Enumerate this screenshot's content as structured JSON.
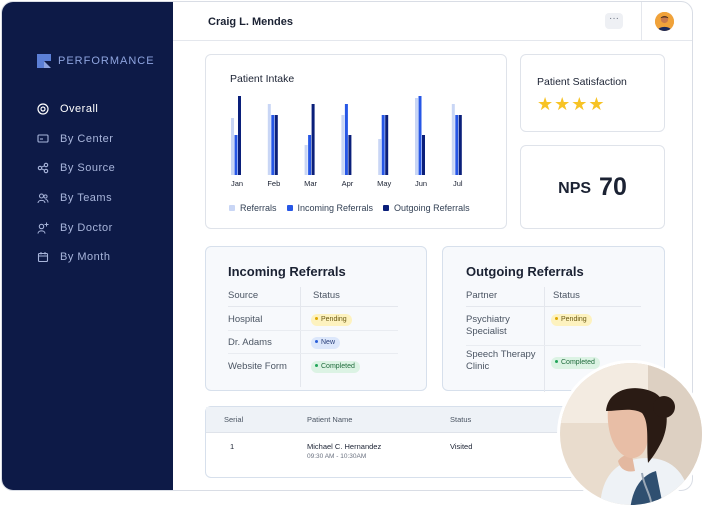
{
  "sidebar": {
    "brand": "PERFORMANCE",
    "items": [
      {
        "label": "Overall",
        "icon": "dashboard-icon",
        "active": true
      },
      {
        "label": "By Center",
        "icon": "monitor-icon",
        "active": false
      },
      {
        "label": "By Source",
        "icon": "share-icon",
        "active": false
      },
      {
        "label": "By Teams",
        "icon": "team-icon",
        "active": false
      },
      {
        "label": "By Doctor",
        "icon": "doctor-add-icon",
        "active": false
      },
      {
        "label": "By Month",
        "icon": "calendar-icon",
        "active": false
      }
    ]
  },
  "header": {
    "user_name": "Craig L. Mendes",
    "more_label": "···"
  },
  "patient_intake": {
    "title": "Patient Intake",
    "chart_data": {
      "type": "bar",
      "categories": [
        "Jan",
        "Feb",
        "Mar",
        "Apr",
        "May",
        "Jun",
        "Jul"
      ],
      "series": [
        {
          "name": "Referrals",
          "color": "#c9d6f5",
          "values": [
            57,
            71,
            30,
            60,
            36,
            77,
            71
          ]
        },
        {
          "name": "Incoming Referrals",
          "color": "#2757e6",
          "values": [
            40,
            60,
            40,
            71,
            60,
            79,
            60
          ]
        },
        {
          "name": "Outgoing Referrals",
          "color": "#0a1f7a",
          "values": [
            79,
            60,
            71,
            40,
            60,
            40,
            60
          ]
        }
      ],
      "ylim": [
        0,
        80
      ],
      "legend": "bottom"
    }
  },
  "satisfaction": {
    "title": "Patient Satisfaction",
    "rating": 4,
    "star_glyph": "★"
  },
  "nps": {
    "label": "NPS",
    "value": "70"
  },
  "incoming": {
    "title": "Incoming Referrals",
    "columns": [
      "Source",
      "Status"
    ],
    "rows": [
      {
        "name": "Hospital",
        "status": "Pending",
        "kind": "pending"
      },
      {
        "name": "Dr. Adams",
        "status": "New",
        "kind": "new"
      },
      {
        "name": "Website Form",
        "status": "Completed",
        "kind": "completed"
      }
    ]
  },
  "outgoing": {
    "title": "Outgoing Referrals",
    "columns": [
      "Partner",
      "Status"
    ],
    "rows": [
      {
        "name": "Psychiatry Specialist",
        "status": "Pending",
        "kind": "pending"
      },
      {
        "name": "Speech Therapy Clinic",
        "status": "Completed",
        "kind": "completed"
      }
    ]
  },
  "patients_table": {
    "columns": [
      "Serial",
      "Patient Name",
      "Status"
    ],
    "rows": [
      {
        "serial": "1",
        "name": "Michael C. Hernandez",
        "time": "09:30 AM - 10:30AM",
        "status": "Visited"
      }
    ]
  },
  "colors": {
    "sidebar_bg": "#0d1a47",
    "accent": "#2757e6",
    "star": "#f7c325"
  }
}
